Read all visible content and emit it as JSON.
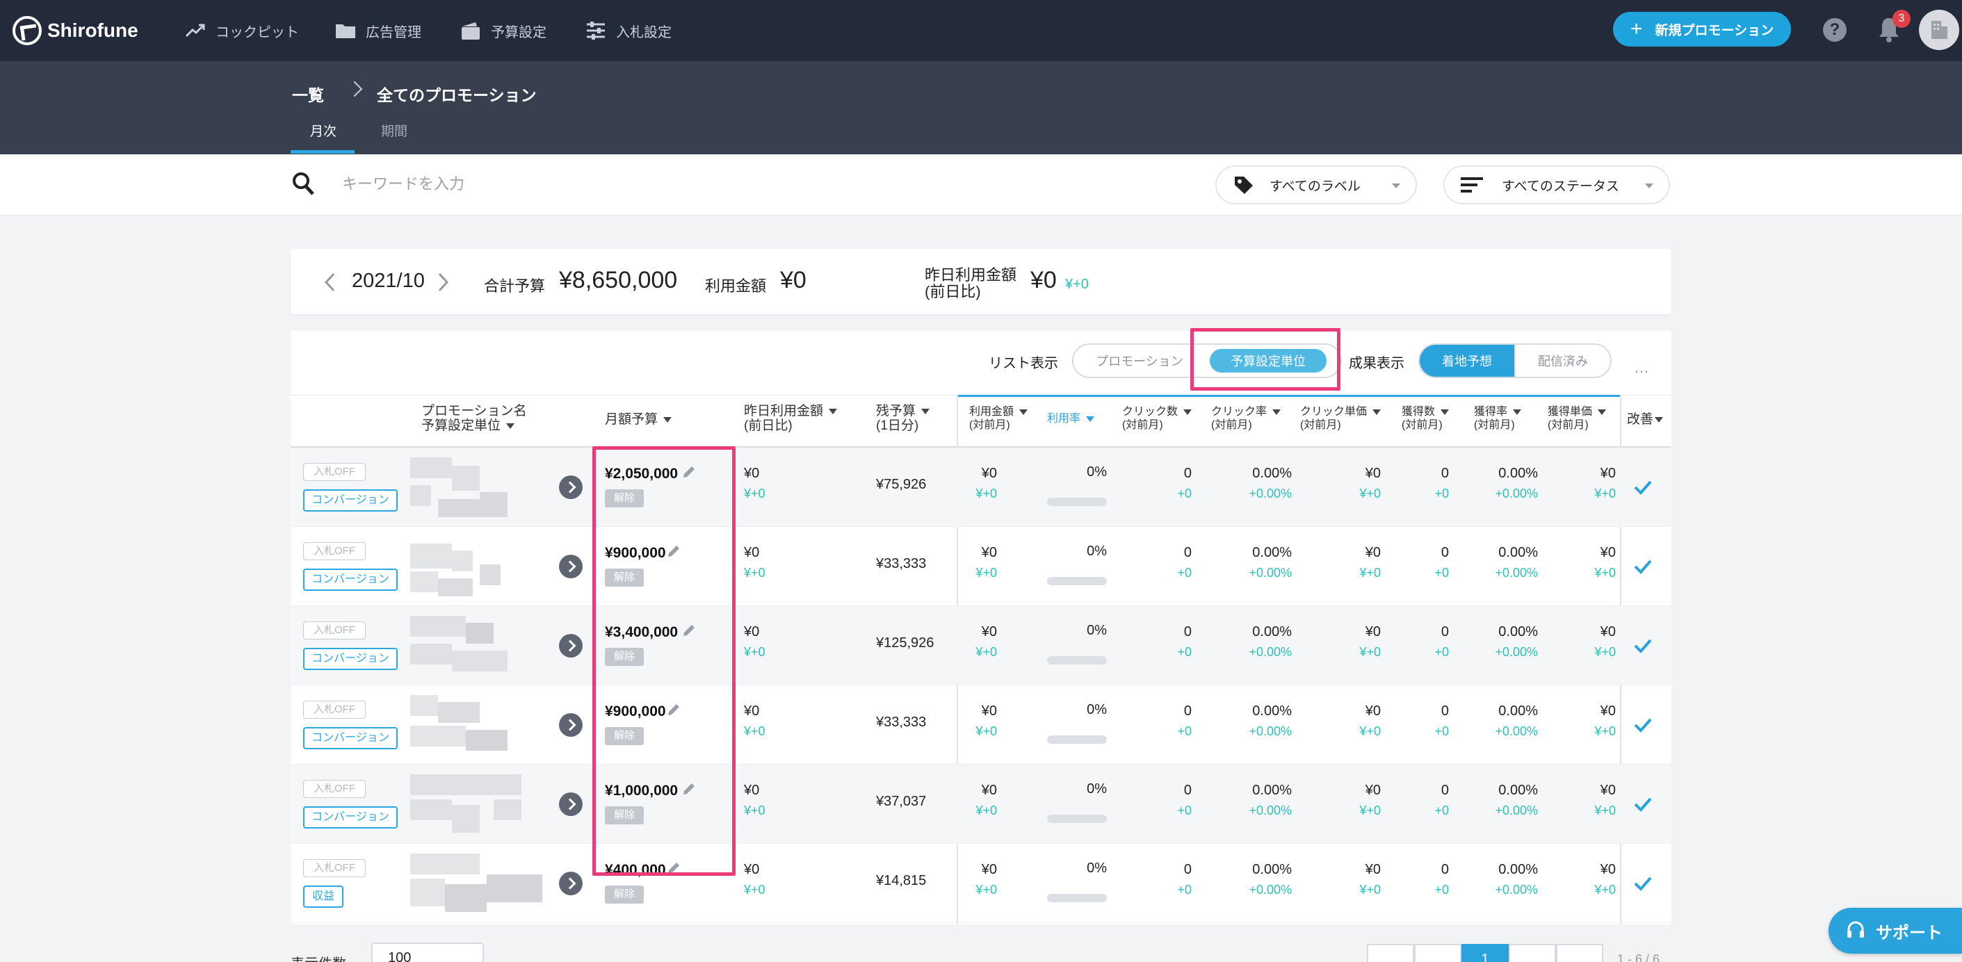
{
  "app": {
    "logo_text": "Shirofune"
  },
  "nav": {
    "items": [
      {
        "label": "コックピット",
        "icon": "trend-icon"
      },
      {
        "label": "広告管理",
        "icon": "folder-icon"
      },
      {
        "label": "予算設定",
        "icon": "wallet-icon"
      },
      {
        "label": "入札設定",
        "icon": "sliders-icon"
      }
    ],
    "new_promotion": "新規プロモーション",
    "notification_count": "3"
  },
  "breadcrumb": {
    "root": "一覧",
    "current": "全てのプロモーション"
  },
  "tabs": {
    "monthly": "月次",
    "period": "期間"
  },
  "search": {
    "placeholder": "キーワードを入力",
    "label_filter": "すべてのラベル",
    "status_filter": "すべてのステータス"
  },
  "summary": {
    "month": "2021/10",
    "total_budget_label": "合計予算",
    "total_budget": "¥8,650,000",
    "usage_label": "利用金額",
    "usage": "¥0",
    "yesterday_label_1": "昨日利用金額",
    "yesterday_label_2": "(前日比)",
    "yesterday": "¥0",
    "yesterday_diff": "¥+0"
  },
  "toolbar": {
    "list_label": "リスト表示",
    "list_opt_promotion": "プロモーション",
    "list_opt_budget_unit": "予算設定単位",
    "result_label": "成果表示",
    "result_opt_forecast": "着地予想",
    "result_opt_delivered": "配信済み",
    "more": "…"
  },
  "columns": {
    "name_1": "プロモーション名",
    "name_2": "予算設定単位",
    "monthly_budget": "月額予算",
    "yday_1": "昨日利用金額",
    "yday_2": "(前日比)",
    "remain_1": "残予算",
    "remain_2": "(1日分)",
    "spend_1": "利用金額",
    "spend_2": "(対前月)",
    "usage_rate": "利用率",
    "clicks_1": "クリック数",
    "clicks_2": "(対前月)",
    "ctr_1": "クリック率",
    "ctr_2": "(対前月)",
    "cpc_1": "クリック単価",
    "cpc_2": "(対前月)",
    "conv_1": "獲得数",
    "conv_2": "(対前月)",
    "cvr_1": "獲得率",
    "cvr_2": "(対前月)",
    "cpa_1": "獲得単価",
    "cpa_2": "(対前月)",
    "improve": "改善"
  },
  "rows": [
    {
      "bid_tag": "入札OFF",
      "type_tag": "コンバージョン",
      "budget": "¥2,050,000",
      "unlock": "解除",
      "yday": "¥0",
      "yday_diff": "¥+0",
      "remain": "¥75,926",
      "spend": "¥0",
      "spend_diff": "¥+0",
      "rate": "0%",
      "rate_value": 0,
      "clicks": "0",
      "clicks_diff": "+0",
      "ctr": "0.00%",
      "ctr_diff": "+0.00%",
      "cpc": "¥0",
      "cpc_diff": "¥+0",
      "conv": "0",
      "conv_diff": "+0",
      "cvr": "0.00%",
      "cvr_diff": "+0.00%",
      "cpa": "¥0",
      "cpa_diff": "¥+0"
    },
    {
      "bid_tag": "入札OFF",
      "type_tag": "コンバージョン",
      "budget": "¥900,000",
      "unlock": "解除",
      "yday": "¥0",
      "yday_diff": "¥+0",
      "remain": "¥33,333",
      "spend": "¥0",
      "spend_diff": "¥+0",
      "rate": "0%",
      "rate_value": 0,
      "clicks": "0",
      "clicks_diff": "+0",
      "ctr": "0.00%",
      "ctr_diff": "+0.00%",
      "cpc": "¥0",
      "cpc_diff": "¥+0",
      "conv": "0",
      "conv_diff": "+0",
      "cvr": "0.00%",
      "cvr_diff": "+0.00%",
      "cpa": "¥0",
      "cpa_diff": "¥+0"
    },
    {
      "bid_tag": "入札OFF",
      "type_tag": "コンバージョン",
      "budget": "¥3,400,000",
      "unlock": "解除",
      "yday": "¥0",
      "yday_diff": "¥+0",
      "remain": "¥125,926",
      "spend": "¥0",
      "spend_diff": "¥+0",
      "rate": "0%",
      "rate_value": 0,
      "clicks": "0",
      "clicks_diff": "+0",
      "ctr": "0.00%",
      "ctr_diff": "+0.00%",
      "cpc": "¥0",
      "cpc_diff": "¥+0",
      "conv": "0",
      "conv_diff": "+0",
      "cvr": "0.00%",
      "cvr_diff": "+0.00%",
      "cpa": "¥0",
      "cpa_diff": "¥+0"
    },
    {
      "bid_tag": "入札OFF",
      "type_tag": "コンバージョン",
      "budget": "¥900,000",
      "unlock": "解除",
      "yday": "¥0",
      "yday_diff": "¥+0",
      "remain": "¥33,333",
      "spend": "¥0",
      "spend_diff": "¥+0",
      "rate": "0%",
      "rate_value": 0,
      "clicks": "0",
      "clicks_diff": "+0",
      "ctr": "0.00%",
      "ctr_diff": "+0.00%",
      "cpc": "¥0",
      "cpc_diff": "¥+0",
      "conv": "0",
      "conv_diff": "+0",
      "cvr": "0.00%",
      "cvr_diff": "+0.00%",
      "cpa": "¥0",
      "cpa_diff": "¥+0"
    },
    {
      "bid_tag": "入札OFF",
      "type_tag": "コンバージョン",
      "budget": "¥1,000,000",
      "unlock": "解除",
      "yday": "¥0",
      "yday_diff": "¥+0",
      "remain": "¥37,037",
      "spend": "¥0",
      "spend_diff": "¥+0",
      "rate": "0%",
      "rate_value": 0,
      "clicks": "0",
      "clicks_diff": "+0",
      "ctr": "0.00%",
      "ctr_diff": "+0.00%",
      "cpc": "¥0",
      "cpc_diff": "¥+0",
      "conv": "0",
      "conv_diff": "+0",
      "cvr": "0.00%",
      "cvr_diff": "+0.00%",
      "cpa": "¥0",
      "cpa_diff": "¥+0"
    },
    {
      "bid_tag": "入札OFF",
      "type_tag": "収益",
      "budget": "¥400,000",
      "unlock": "解除",
      "yday": "¥0",
      "yday_diff": "¥+0",
      "remain": "¥14,815",
      "spend": "¥0",
      "spend_diff": "¥+0",
      "rate": "0%",
      "rate_value": 0,
      "clicks": "0",
      "clicks_diff": "+0",
      "ctr": "0.00%",
      "ctr_diff": "+0.00%",
      "cpc": "¥0",
      "cpc_diff": "¥+0",
      "conv": "0",
      "conv_diff": "+0",
      "cvr": "0.00%",
      "cvr_diff": "+0.00%",
      "cpa": "¥0",
      "cpa_diff": "¥+0"
    }
  ],
  "footer": {
    "per_page_label": "表示件数",
    "per_page": "100",
    "current_page": "1",
    "count": "1 - 6 / 6"
  },
  "support": "サポート",
  "colors": {
    "accent": "#2aa3dc",
    "highlight": "#ea3c7a",
    "nav_bg": "#232b3b",
    "positive": "#2cc0b7"
  }
}
